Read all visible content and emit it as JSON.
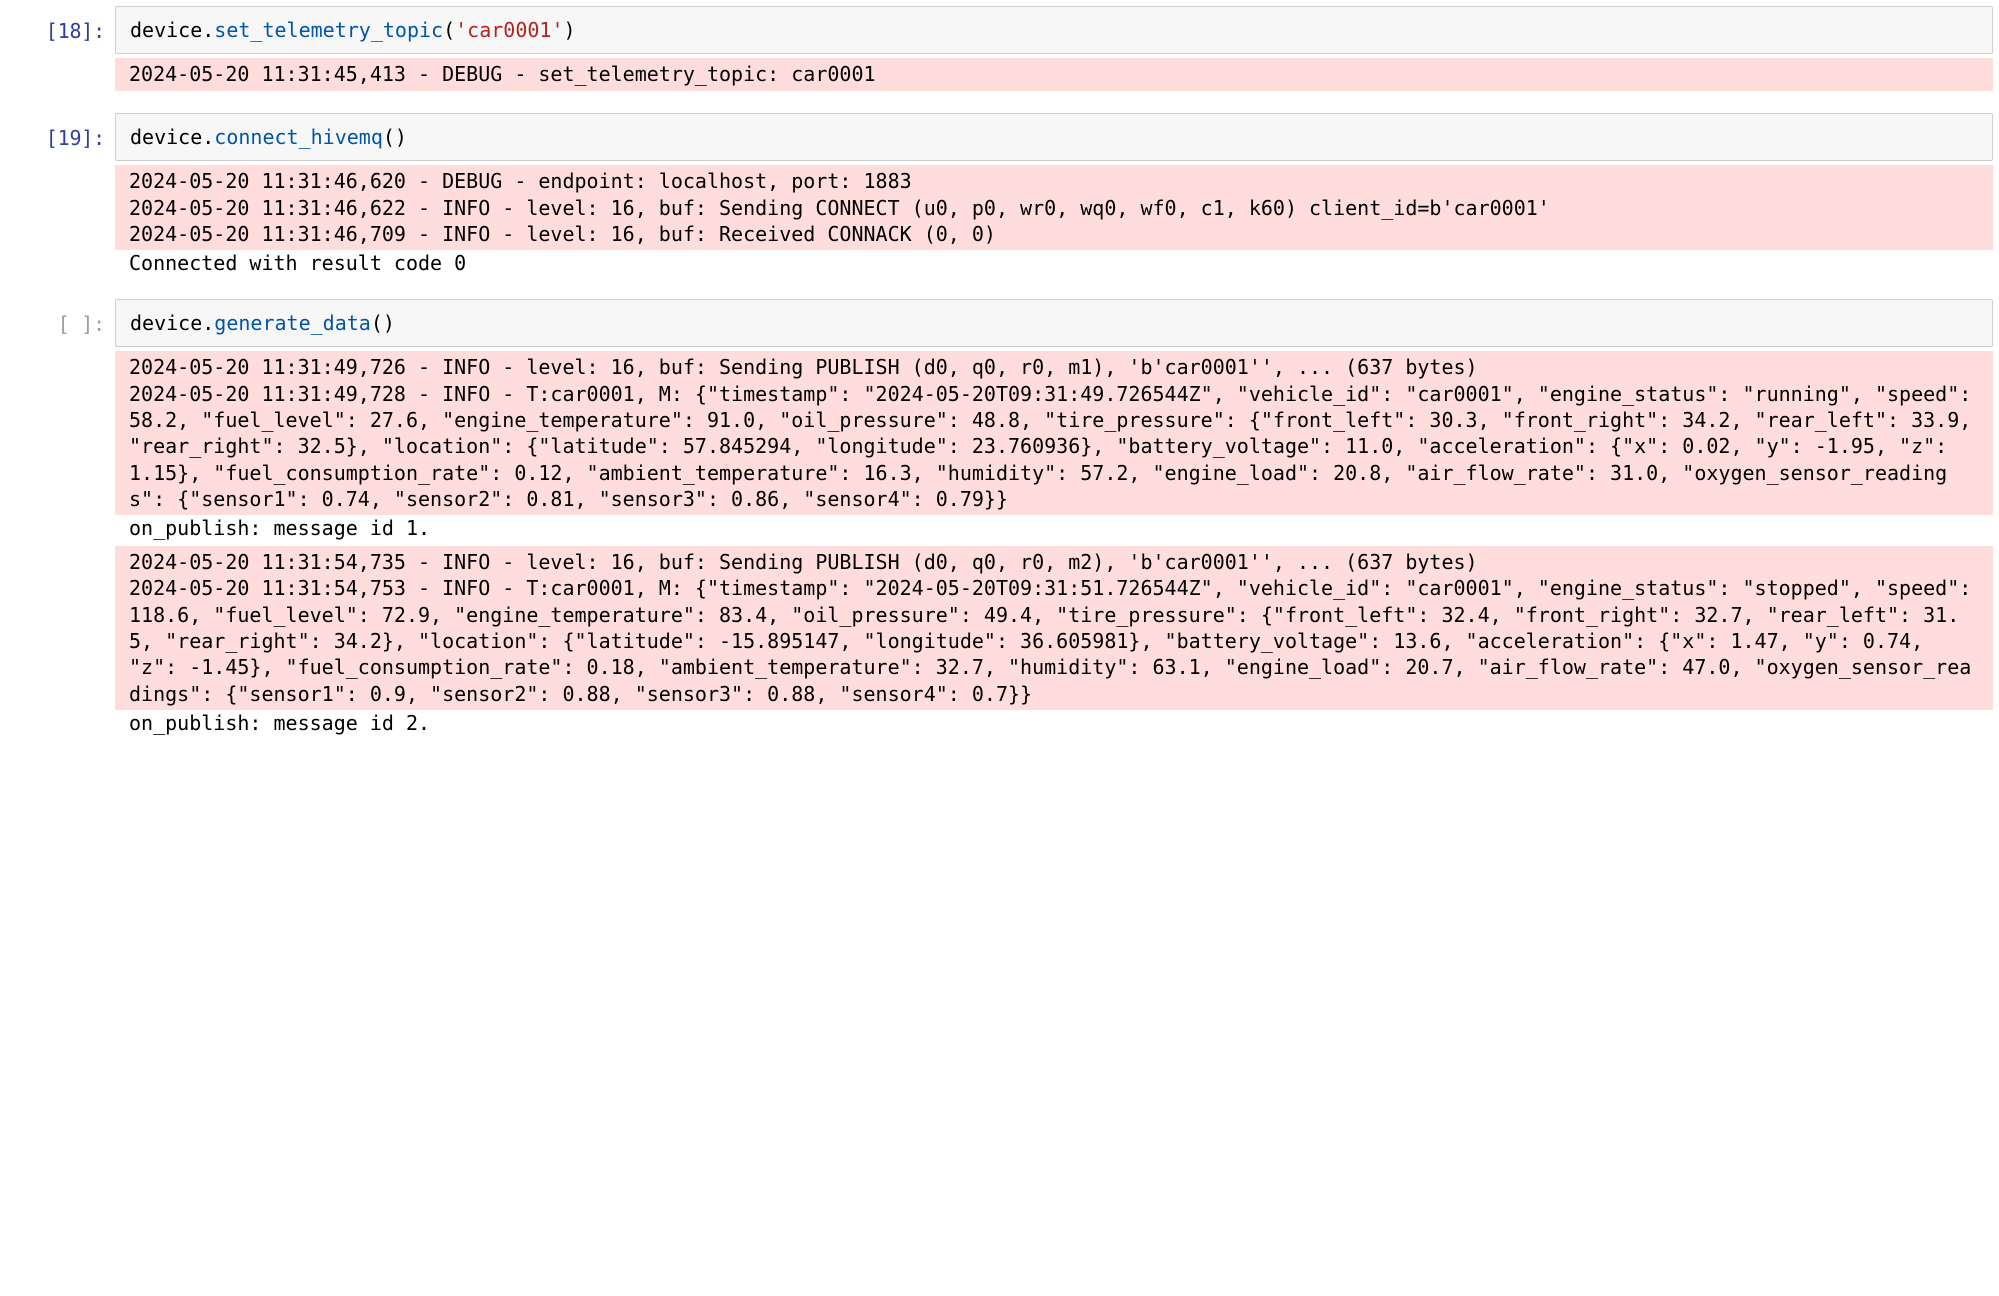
{
  "cells": [
    {
      "prompt": "[18]:",
      "code": {
        "obj": "device.",
        "method": "set_telemetry_topic",
        "open": "(",
        "arg": "'car0001'",
        "close": ")"
      },
      "outputs": [
        {
          "kind": "stderr",
          "text": "2024-05-20 11:31:45,413 - DEBUG - set_telemetry_topic: car0001"
        }
      ]
    },
    {
      "prompt": "[19]:",
      "code": {
        "obj": "device.",
        "method": "connect_hivemq",
        "open": "(",
        "arg": "",
        "close": ")"
      },
      "outputs": [
        {
          "kind": "stderr",
          "text": "2024-05-20 11:31:46,620 - DEBUG - endpoint: localhost, port: 1883\n2024-05-20 11:31:46,622 - INFO - level: 16, buf: Sending CONNECT (u0, p0, wr0, wq0, wf0, c1, k60) client_id=b'car0001'\n2024-05-20 11:31:46,709 - INFO - level: 16, buf: Received CONNACK (0, 0)"
        },
        {
          "kind": "stdout",
          "text": "Connected with result code 0"
        }
      ]
    },
    {
      "prompt": "[ ]:",
      "code": {
        "obj": "device.",
        "method": "generate_data",
        "open": "(",
        "arg": "",
        "close": ")"
      },
      "outputs": [
        {
          "kind": "stderr",
          "text": "2024-05-20 11:31:49,726 - INFO - level: 16, buf: Sending PUBLISH (d0, q0, r0, m1), 'b'car0001'', ... (637 bytes)\n2024-05-20 11:31:49,728 - INFO - T:car0001, M: {\"timestamp\": \"2024-05-20T09:31:49.726544Z\", \"vehicle_id\": \"car0001\", \"engine_status\": \"running\", \"speed\": 58.2, \"fuel_level\": 27.6, \"engine_temperature\": 91.0, \"oil_pressure\": 48.8, \"tire_pressure\": {\"front_left\": 30.3, \"front_right\": 34.2, \"rear_left\": 33.9, \"rear_right\": 32.5}, \"location\": {\"latitude\": 57.845294, \"longitude\": 23.760936}, \"battery_voltage\": 11.0, \"acceleration\": {\"x\": 0.02, \"y\": -1.95, \"z\": 1.15}, \"fuel_consumption_rate\": 0.12, \"ambient_temperature\": 16.3, \"humidity\": 57.2, \"engine_load\": 20.8, \"air_flow_rate\": 31.0, \"oxygen_sensor_readings\": {\"sensor1\": 0.74, \"sensor2\": 0.81, \"sensor3\": 0.86, \"sensor4\": 0.79}}"
        },
        {
          "kind": "stdout",
          "text": "on_publish: message id 1."
        },
        {
          "kind": "stderr",
          "text": "2024-05-20 11:31:54,735 - INFO - level: 16, buf: Sending PUBLISH (d0, q0, r0, m2), 'b'car0001'', ... (637 bytes)\n2024-05-20 11:31:54,753 - INFO - T:car0001, M: {\"timestamp\": \"2024-05-20T09:31:51.726544Z\", \"vehicle_id\": \"car0001\", \"engine_status\": \"stopped\", \"speed\": 118.6, \"fuel_level\": 72.9, \"engine_temperature\": 83.4, \"oil_pressure\": 49.4, \"tire_pressure\": {\"front_left\": 32.4, \"front_right\": 32.7, \"rear_left\": 31.5, \"rear_right\": 34.2}, \"location\": {\"latitude\": -15.895147, \"longitude\": 36.605981}, \"battery_voltage\": 13.6, \"acceleration\": {\"x\": 1.47, \"y\": 0.74, \"z\": -1.45}, \"fuel_consumption_rate\": 0.18, \"ambient_temperature\": 32.7, \"humidity\": 63.1, \"engine_load\": 20.7, \"air_flow_rate\": 47.0, \"oxygen_sensor_readings\": {\"sensor1\": 0.9, \"sensor2\": 0.88, \"sensor3\": 0.88, \"sensor4\": 0.7}}"
        },
        {
          "kind": "stdout",
          "text": "on_publish: message id 2."
        }
      ]
    }
  ]
}
